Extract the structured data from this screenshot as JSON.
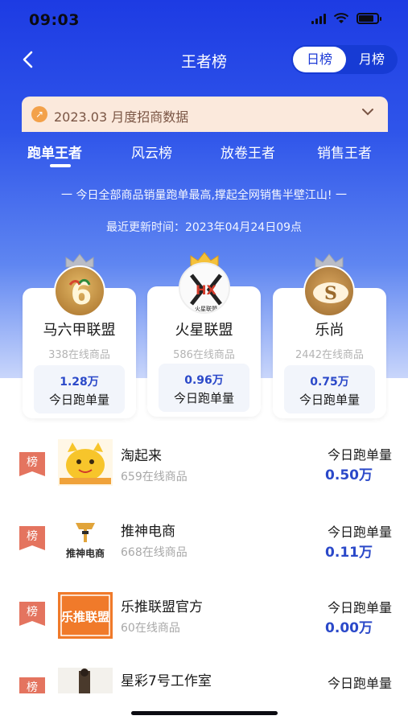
{
  "status": {
    "time": "09:03"
  },
  "nav": {
    "title": "王者榜",
    "toggle_day": "日榜",
    "toggle_month": "月榜"
  },
  "banner": {
    "text": "2023.03 月度招商数据"
  },
  "tabs": [
    "跑单王者",
    "风云榜",
    "放卷王者",
    "销售王者"
  ],
  "slogan": "一  今日全部商品销量跑单最高,撑起全网销售半壁江山!  一",
  "updated": "最近更新时间：2023年04月24日09点",
  "podium": [
    {
      "name": "马六甲联盟",
      "sub": "338在线商品",
      "value": "1.28万",
      "label": "今日跑单量"
    },
    {
      "name": "火星联盟",
      "sub": "586在线商品",
      "value": "0.96万",
      "label": "今日跑单量",
      "logo_text": "火星联盟"
    },
    {
      "name": "乐尚",
      "sub": "2442在线商品",
      "value": "0.75万",
      "label": "今日跑单量"
    }
  ],
  "list": [
    {
      "badge": "榜",
      "name": "淘起来",
      "sub": "659在线商品",
      "label": "今日跑单量",
      "value": "0.50万"
    },
    {
      "badge": "榜",
      "name": "推神电商",
      "sub": "668在线商品",
      "label": "今日跑单量",
      "value": "0.11万",
      "logo_text": "推神电商"
    },
    {
      "badge": "榜",
      "name": "乐推联盟官方",
      "sub": "60在线商品",
      "label": "今日跑单量",
      "value": "0.00万",
      "logo_text": "乐推联盟"
    },
    {
      "badge": "榜",
      "name": "星彩7号工作室",
      "sub": "",
      "label": "今日跑单量",
      "value": ""
    }
  ],
  "colors": {
    "primary": "#1d3be3",
    "value_blue": "#2b49c9",
    "badge": "#e4745f",
    "banner_bg": "#fbe9dc"
  }
}
